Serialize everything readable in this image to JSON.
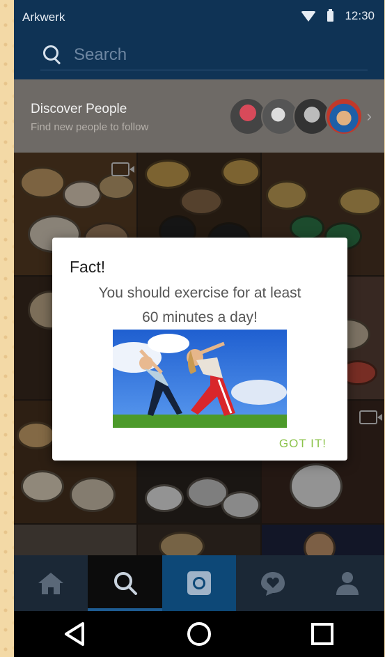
{
  "status_bar": {
    "carrier": "Arkwerk",
    "time": "12:30"
  },
  "search": {
    "placeholder": "Search"
  },
  "discover": {
    "title": "Discover People",
    "subtitle": "Find new people to follow"
  },
  "dialog": {
    "title": "Fact!",
    "message_line1": "You should exercise for at least",
    "message_line2": "60 minutes a day!",
    "button": "GOT IT!"
  },
  "bottom_nav": [
    "home-icon",
    "search-icon",
    "camera-icon",
    "activity-heart-icon",
    "profile-icon"
  ],
  "system_nav": [
    "back-icon",
    "home-circle-icon",
    "recents-icon"
  ],
  "colors": {
    "status_bar": "#0f3355",
    "accent_button": "#8bc34a",
    "nav_active": "#0d4877"
  }
}
